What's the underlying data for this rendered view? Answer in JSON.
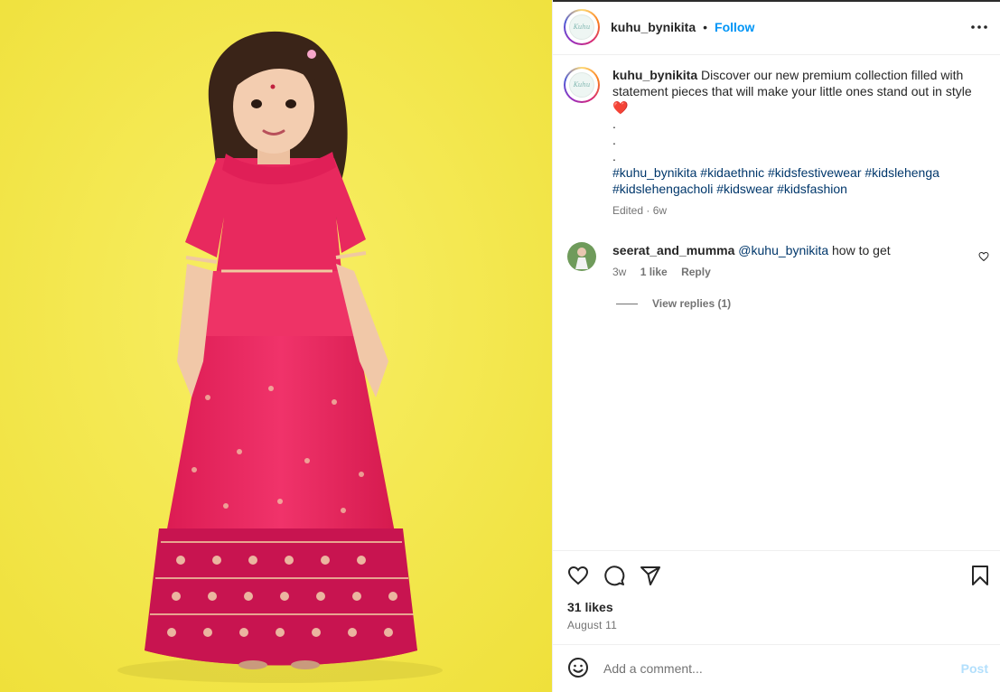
{
  "header": {
    "username": "kuhu_bynikita",
    "separator": "•",
    "follow_label": "Follow",
    "more_label": "•••",
    "avatar_text": "Kuhu"
  },
  "caption": {
    "username": "kuhu_bynikita",
    "text": "Discover our new premium collection filled with statement pieces that will make your little ones stand out in style",
    "emoji": "❤️",
    "dots": [
      ".",
      ".",
      "."
    ],
    "hashtags_line1": "#kuhu_bynikita #kidaethnic #kidsfestivewear #kidslehenga",
    "hashtags_line2": "#kidslehengacholi #kidswear #kidsfashion",
    "meta": "Edited · 6w"
  },
  "comment": {
    "username": "seerat_and_mumma",
    "mention": "@kuhu_bynikita",
    "text": "how to get",
    "age": "3w",
    "likes": "1 like",
    "reply_label": "Reply"
  },
  "view_replies": "View replies (1)",
  "post": {
    "likes": "31 likes",
    "date": "August 11"
  },
  "comment_box": {
    "placeholder": "Add a comment...",
    "post_label": "Post"
  },
  "colors": {
    "accent": "#0095f6",
    "hashtag": "#00376b",
    "photo_bg": "#f6e94a",
    "lehenga": "#e8295e"
  }
}
